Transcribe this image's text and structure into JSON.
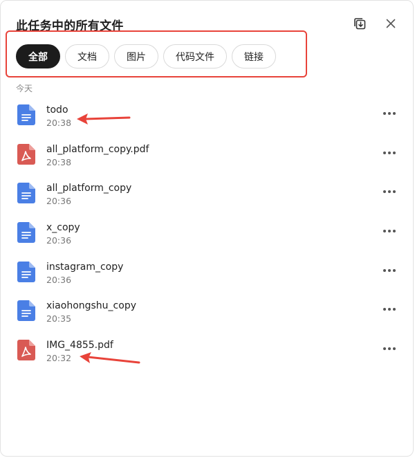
{
  "dialog": {
    "title": "此任务中的所有文件"
  },
  "filters": [
    {
      "label": "全部",
      "active": true
    },
    {
      "label": "文档",
      "active": false
    },
    {
      "label": "图片",
      "active": false
    },
    {
      "label": "代码文件",
      "active": false
    },
    {
      "label": "链接",
      "active": false
    }
  ],
  "section": {
    "label": "今天"
  },
  "files": [
    {
      "name": "todo",
      "time": "20:38",
      "type": "doc"
    },
    {
      "name": "all_platform_copy.pdf",
      "time": "20:38",
      "type": "pdf"
    },
    {
      "name": "all_platform_copy",
      "time": "20:36",
      "type": "doc"
    },
    {
      "name": "x_copy",
      "time": "20:36",
      "type": "doc"
    },
    {
      "name": "instagram_copy",
      "time": "20:36",
      "type": "doc"
    },
    {
      "name": "xiaohongshu_copy",
      "time": "20:35",
      "type": "doc"
    },
    {
      "name": "IMG_4855.pdf",
      "time": "20:32",
      "type": "pdf"
    }
  ],
  "colors": {
    "doc_icon": "#4a7fe5",
    "pdf_icon": "#d95a54",
    "annotation_red": "#e8433a",
    "active_chip": "#1c1c1c"
  },
  "icons": {
    "download": "download-all-icon",
    "close": "close-icon",
    "more": "more-dots-icon"
  }
}
